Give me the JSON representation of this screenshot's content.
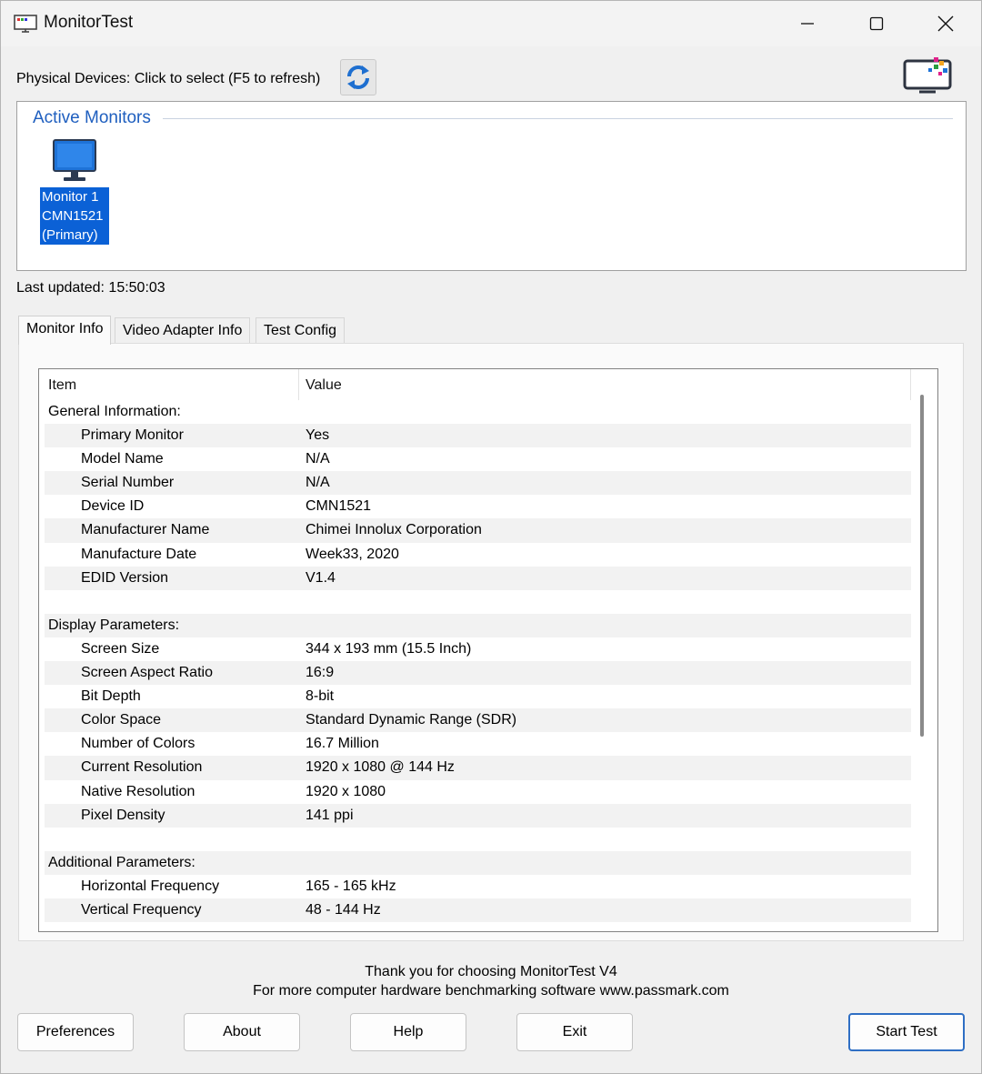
{
  "window": {
    "title": "MonitorTest"
  },
  "top": {
    "physical_devices_label": "Physical Devices: Click to select (F5 to refresh)"
  },
  "active_monitors": {
    "title": "Active Monitors",
    "monitors": [
      {
        "line1": "Monitor 1",
        "line2": "CMN1521",
        "line3": "(Primary)"
      }
    ]
  },
  "last_updated": "Last updated: 15:50:03",
  "tabs": [
    {
      "label": "Monitor Info",
      "active": true
    },
    {
      "label": "Video Adapter Info",
      "active": false
    },
    {
      "label": "Test Config",
      "active": false
    }
  ],
  "table": {
    "columns": [
      "Item",
      "Value"
    ],
    "rows": [
      {
        "kind": "section",
        "item": "General Information:",
        "value": ""
      },
      {
        "kind": "item",
        "item": "Primary Monitor",
        "value": "Yes"
      },
      {
        "kind": "item",
        "item": "Model Name",
        "value": "N/A"
      },
      {
        "kind": "item",
        "item": "Serial Number",
        "value": "N/A"
      },
      {
        "kind": "item",
        "item": "Device ID",
        "value": "CMN1521"
      },
      {
        "kind": "item",
        "item": "Manufacturer Name",
        "value": "Chimei Innolux Corporation"
      },
      {
        "kind": "item",
        "item": "Manufacture Date",
        "value": "Week33, 2020"
      },
      {
        "kind": "item",
        "item": "EDID Version",
        "value": "V1.4"
      },
      {
        "kind": "blank",
        "item": "",
        "value": ""
      },
      {
        "kind": "section",
        "item": "Display Parameters:",
        "value": ""
      },
      {
        "kind": "item",
        "item": "Screen Size",
        "value": "344 x 193 mm (15.5 Inch)"
      },
      {
        "kind": "item",
        "item": "Screen Aspect Ratio",
        "value": "16:9"
      },
      {
        "kind": "item",
        "item": "Bit Depth",
        "value": "8-bit"
      },
      {
        "kind": "item",
        "item": "Color Space",
        "value": "Standard Dynamic Range (SDR)"
      },
      {
        "kind": "item",
        "item": "Number of Colors",
        "value": "16.7 Million"
      },
      {
        "kind": "item",
        "item": "Current Resolution",
        "value": "1920 x 1080 @ 144 Hz"
      },
      {
        "kind": "item",
        "item": "Native Resolution",
        "value": "1920 x 1080"
      },
      {
        "kind": "item",
        "item": "Pixel Density",
        "value": "141 ppi"
      },
      {
        "kind": "blank",
        "item": "",
        "value": ""
      },
      {
        "kind": "section",
        "item": "Additional Parameters:",
        "value": ""
      },
      {
        "kind": "item",
        "item": "Horizontal Frequency",
        "value": "165 - 165 kHz"
      },
      {
        "kind": "item",
        "item": "Vertical Frequency",
        "value": "48 - 144 Hz"
      }
    ]
  },
  "footer": {
    "line1": "Thank you for choosing MonitorTest V4",
    "line2": "For more computer hardware benchmarking software www.passmark.com"
  },
  "buttons": {
    "preferences": "Preferences",
    "about": "About",
    "help": "Help",
    "exit": "Exit",
    "start_test": "Start Test"
  },
  "colors": {
    "accent": "#1f5fbf",
    "selection": "#0b61d6",
    "monitor_icon": "#1e73d8"
  },
  "icons": {
    "app": "monitor-test-app-icon",
    "refresh": "refresh-icon",
    "monitor": "monitor-icon",
    "brand": "passmark-monitor-logo-icon"
  }
}
